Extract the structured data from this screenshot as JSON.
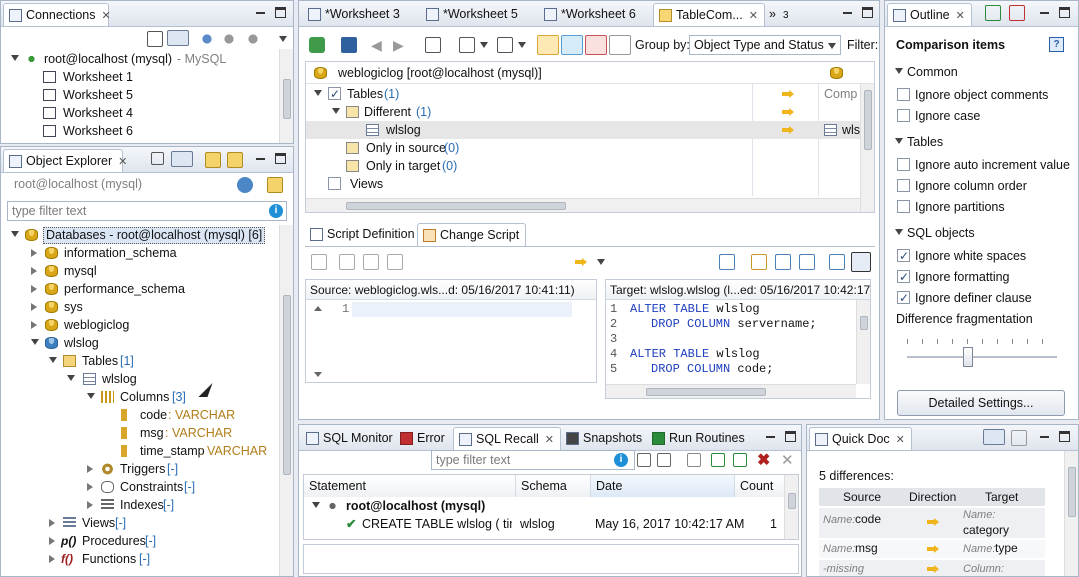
{
  "connections": {
    "tab_label": "Connections",
    "root": "root@localhost (mysql)",
    "root_suffix": " - MySQL",
    "worksheets": [
      "Worksheet 1",
      "Worksheet 5",
      "Worksheet 4",
      "Worksheet 6"
    ]
  },
  "object_explorer": {
    "tab_label": "Object Explorer",
    "connection": "root@localhost (mysql)",
    "filter_placeholder": "type filter text",
    "databases_label": "Databases - root@localhost (mysql) [6]",
    "databases": [
      "information_schema",
      "mysql",
      "performance_schema",
      "sys",
      "weblogiclog",
      "wlslog"
    ],
    "tables_label": "Tables",
    "tables_count": "[1]",
    "table_name": "wlslog",
    "columns_label": "Columns",
    "columns_count": "[3]",
    "columns": [
      {
        "name": "code",
        "type": " : VARCHAR"
      },
      {
        "name": "msg",
        "type": " : VARCHAR"
      },
      {
        "name": "time_stamp",
        "type": " : VARCHAR"
      }
    ],
    "triggers_label": "Triggers",
    "constraints_label": "Constraints",
    "indexes_label": "Indexes",
    "views_label": "Views",
    "procedures_label": "Procedures",
    "functions_label": "Functions",
    "empty_marker": "[-]"
  },
  "editor_tabs": [
    {
      "label": "*Worksheet 3"
    },
    {
      "label": "*Worksheet 5"
    },
    {
      "label": "*Worksheet 6"
    },
    {
      "label": "TableCom..."
    },
    {
      "label": "3"
    }
  ],
  "compare": {
    "group_by_label": "Group by:",
    "group_by_value": "Object Type and Status",
    "filter_label": "Filter:",
    "source_header": "weblogiclog [root@localhost (mysql)]",
    "target_header_partial": "Comp",
    "tables_label": "Tables",
    "tables_count": "(1)",
    "different_label": "Different",
    "different_count": "(1)",
    "different_item": "wlslog",
    "target_item_partial": "wls",
    "only_source_label": "Only in source",
    "only_source_count": "(0)",
    "only_target_label": "Only in target",
    "only_target_count": "(0)",
    "views_label": "Views"
  },
  "script": {
    "tab_definition": "Script Definition",
    "tab_change": "Change Script",
    "source_header": "Source: weblogiclog.wls...d: 05/16/2017 10:41:11)",
    "target_header": "Target: wlslog.wlslog (l...ed: 05/16/2017 10:42:17)",
    "source_line_numbers": [
      "1"
    ],
    "target_lines": [
      {
        "num": "1",
        "kw": "ALTER TABLE",
        "rest": " wlslog",
        "indent": false
      },
      {
        "num": "2",
        "kw": "DROP COLUMN",
        "rest": " servername;",
        "indent": true
      },
      {
        "num": "3",
        "kw": "",
        "rest": "",
        "indent": false
      },
      {
        "num": "4",
        "kw": "ALTER TABLE",
        "rest": " wlslog",
        "indent": false
      },
      {
        "num": "5",
        "kw": "DROP COLUMN",
        "rest": " code;",
        "indent": true
      }
    ]
  },
  "outline": {
    "tab_label": "Outline",
    "title": "Comparison items",
    "common_label": "Common",
    "common_options": [
      {
        "label": "Ignore object comments",
        "checked": false
      },
      {
        "label": "Ignore case",
        "checked": false
      }
    ],
    "tables_label": "Tables",
    "tables_options": [
      {
        "label": "Ignore auto increment value",
        "checked": false
      },
      {
        "label": "Ignore column order",
        "checked": false
      },
      {
        "label": "Ignore partitions",
        "checked": false
      }
    ],
    "sql_label": "SQL objects",
    "sql_options": [
      {
        "label": "Ignore white spaces",
        "checked": true
      },
      {
        "label": "Ignore formatting",
        "checked": true
      },
      {
        "label": "Ignore definer clause",
        "checked": true
      }
    ],
    "fragmentation_label": "Difference fragmentation",
    "fragmentation_level": 0.4,
    "details_button": "Detailed Settings..."
  },
  "bottom": {
    "tabs": [
      "SQL Monitor",
      "Error",
      "SQL Recall",
      "Snapshots",
      "Run Routines"
    ],
    "filter_placeholder": "type filter text",
    "columns": [
      "Statement",
      "Schema",
      "Date",
      "Count"
    ],
    "group": "root@localhost (mysql)",
    "row": {
      "statement": "CREATE TABLE wlslog ( time",
      "schema": "wlslog",
      "date": "May 16, 2017 10:42:17 AM",
      "count": "1"
    }
  },
  "quickdoc": {
    "tab_label": "Quick Doc",
    "summary": "5 differences:",
    "headers": [
      "Source",
      "Direction",
      "Target"
    ],
    "rows": [
      {
        "src_label": "Name:",
        "src_val": " code",
        "tgt_label": "Name:",
        "tgt_val": "category"
      },
      {
        "src_label": "Name:",
        "src_val": " msg",
        "tgt_label": "Name:",
        "tgt_val": " type"
      },
      {
        "src_label": "-missing",
        "src_val": "",
        "tgt_label": "Column:",
        "tgt_val": ""
      }
    ]
  }
}
